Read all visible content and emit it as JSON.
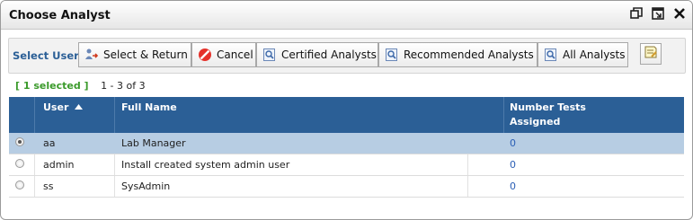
{
  "dialog": {
    "title": "Choose Analyst",
    "icons": [
      "restore-window-icon",
      "popout-window-icon",
      "close-icon"
    ]
  },
  "toolbar": {
    "select_users_label": "Select Users",
    "buttons": [
      {
        "label": "Select & Return",
        "icon": "user-arrow-icon"
      },
      {
        "label": "Cancel",
        "icon": "cancel-icon"
      },
      {
        "label": "Certified Analysts",
        "icon": "magnifier-document-icon"
      },
      {
        "label": "Recommended Analysts",
        "icon": "magnifier-document-icon"
      },
      {
        "label": "All Analysts",
        "icon": "magnifier-document-icon"
      }
    ],
    "note_button_icon": "note-icon"
  },
  "status": {
    "selected": "[ 1 selected ]",
    "range": "1 - 3 of 3"
  },
  "grid": {
    "columns": [
      {
        "label": "User",
        "sort": "ascending"
      },
      {
        "label": "Full Name"
      },
      {
        "label": "Number Tests",
        "label2": "Assigned"
      }
    ],
    "rows": [
      {
        "user": "aa",
        "full_name": "Lab Manager",
        "tests": "0",
        "selected": true
      },
      {
        "user": "admin",
        "full_name": "Install created system admin user",
        "tests": "0",
        "selected": false
      },
      {
        "user": "ss",
        "full_name": "SysAdmin",
        "tests": "0",
        "selected": false
      }
    ]
  },
  "colors": {
    "header_blue": "#2b5f96",
    "selected_row": "#b7cde3",
    "selected_count_green": "#3a9a2a",
    "link_blue": "#2b5fb5"
  }
}
